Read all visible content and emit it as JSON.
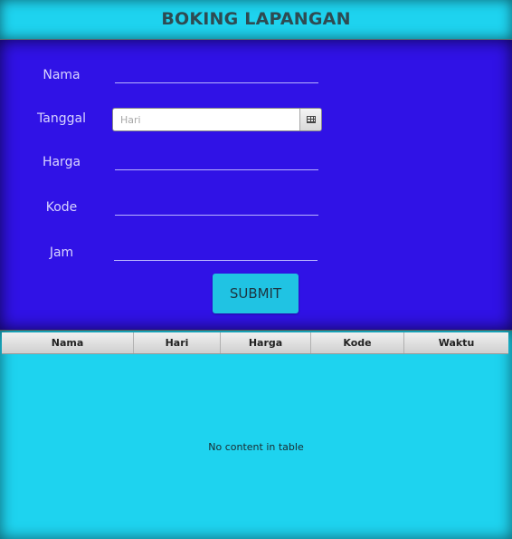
{
  "header": {
    "title": "BOKING LAPANGAN"
  },
  "form": {
    "nama_label": "Nama",
    "tanggal_label": "Tanggal",
    "tanggal_placeholder": "Hari",
    "harga_label": "Harga",
    "kode_label": "Kode",
    "jam_label": "Jam",
    "submit_label": "SUBMIT"
  },
  "table": {
    "columns": [
      "Nama",
      "Hari",
      "Harga",
      "Kode",
      "Waktu"
    ],
    "empty_message": "No content in table"
  },
  "icons": {
    "date_picker": "calendar-icon"
  },
  "colors": {
    "header_bg": "#1ed3ef",
    "form_bg": "#3012e6",
    "button_bg": "#20c3e3",
    "table_bg": "#1ed3ef"
  }
}
